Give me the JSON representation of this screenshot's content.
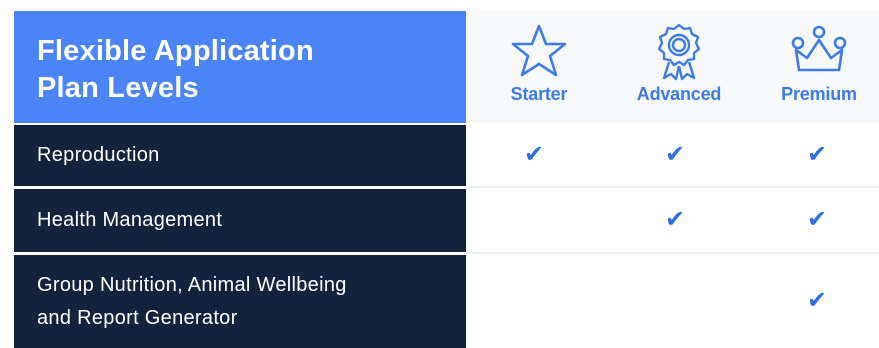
{
  "title": {
    "line1": "Flexible Application",
    "line2": "Plan Levels"
  },
  "plans": [
    {
      "name": "Starter",
      "icon": "star-icon"
    },
    {
      "name": "Advanced",
      "icon": "award-ribbon-icon"
    },
    {
      "name": "Premium",
      "icon": "crown-icon"
    }
  ],
  "rows": [
    {
      "label_lines": [
        "Reproduction"
      ],
      "starter": "✔",
      "advanced": "✔",
      "premium": "✔"
    },
    {
      "label_lines": [
        "Health Management"
      ],
      "advanced": "✔",
      "premium": "✔"
    },
    {
      "label_lines": [
        "Group Nutrition, Animal Wellbeing",
        "and Report Generator"
      ],
      "premium": "✔"
    }
  ],
  "colors": {
    "title_bg": "#4a84f7",
    "label_bg": "#14233d",
    "accent": "#3f7be8",
    "check": "#2f6fe6"
  }
}
